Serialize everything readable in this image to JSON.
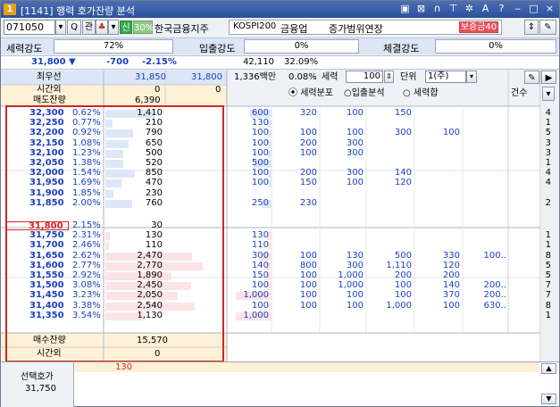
{
  "title": {
    "num": "1",
    "text": "[1141] 행력 호가잔량 분석"
  },
  "toolbar": {
    "code": "071050",
    "search_label": "Q",
    "gwan": "관",
    "sin": "신",
    "pct": "30%",
    "company": "한국금융지주",
    "market": "KOSPI200",
    "sector": "금융업",
    "status": "증가범위연장",
    "badge": "보증금40"
  },
  "strength": {
    "label": "세력강도",
    "value": "72%",
    "inout_label": "입출강도",
    "inout_value": "0%",
    "exec_label": "체결강도",
    "exec_value": "0%"
  },
  "summary": {
    "price": "31,800",
    "arrow": "▼",
    "change": "-700",
    "change_pct": "-2.15%",
    "volume": "42,110",
    "vol_pct": "32.09%",
    "best_label": "최우선",
    "best_ask": "31,850",
    "best_bid": "31,800",
    "amount": "1,336백만",
    "rate": "0.08%",
    "force_label": "세력",
    "force_value": "100",
    "unit_label": "단위",
    "unit_value": "1(주)"
  },
  "header": {
    "offhours": "시간외",
    "sell_total_label": "매도잔량",
    "sell_off_a": "0",
    "sell_off_b": "0",
    "sell_total": "6,390",
    "radio1": "세력분포",
    "radio2": "입출분석",
    "radio3": "세력합",
    "count_label": "건수"
  },
  "sell_rows": [
    {
      "price": "32,300",
      "pct": "0.62%",
      "qty": "1,410",
      "cols": [
        "600",
        "320",
        "100",
        "150",
        "",
        ""
      ],
      "cnt": "4"
    },
    {
      "price": "32,250",
      "pct": "0.77%",
      "qty": "210",
      "cols": [
        "130",
        "",
        "",
        "",
        "",
        ""
      ],
      "cnt": "1"
    },
    {
      "price": "32,200",
      "pct": "0.92%",
      "qty": "790",
      "cols": [
        "100",
        "100",
        "100",
        "300",
        "100",
        ""
      ],
      "cnt": "5"
    },
    {
      "price": "32,150",
      "pct": "1.08%",
      "qty": "650",
      "cols": [
        "100",
        "200",
        "300",
        "",
        "",
        ""
      ],
      "cnt": "3"
    },
    {
      "price": "32,100",
      "pct": "1.23%",
      "qty": "500",
      "cols": [
        "100",
        "100",
        "300",
        "",
        "",
        ""
      ],
      "cnt": "3"
    },
    {
      "price": "32,050",
      "pct": "1.38%",
      "qty": "520",
      "cols": [
        "500",
        "",
        "",
        "",
        "",
        ""
      ],
      "cnt": "1"
    },
    {
      "price": "32,000",
      "pct": "1.54%",
      "qty": "850",
      "cols": [
        "100",
        "200",
        "300",
        "140",
        "",
        ""
      ],
      "cnt": "4"
    },
    {
      "price": "31,950",
      "pct": "1.69%",
      "qty": "470",
      "cols": [
        "100",
        "150",
        "100",
        "120",
        "",
        ""
      ],
      "cnt": "4"
    },
    {
      "price": "31,900",
      "pct": "1.85%",
      "qty": "230",
      "cols": [
        "",
        "",
        "",
        "",
        "",
        ""
      ],
      "cnt": ""
    },
    {
      "price": "31,850",
      "pct": "2.00%",
      "qty": "760",
      "cols": [
        "250",
        "230",
        "",
        "",
        "",
        ""
      ],
      "cnt": "2"
    }
  ],
  "buy_rows": [
    {
      "price": "31,800",
      "pct": "2.15%",
      "qty": "30",
      "cols": [
        "",
        "",
        "",
        "",
        "",
        ""
      ],
      "cnt": ""
    },
    {
      "price": "31,750",
      "pct": "2.31%",
      "qty": "130",
      "cols": [
        "130",
        "",
        "",
        "",
        "",
        ""
      ],
      "cnt": "1"
    },
    {
      "price": "31,700",
      "pct": "2.46%",
      "qty": "110",
      "cols": [
        "110",
        "",
        "",
        "",
        "",
        ""
      ],
      "cnt": "1"
    },
    {
      "price": "31,650",
      "pct": "2.62%",
      "qty": "2,470",
      "cols": [
        "300",
        "100",
        "130",
        "500",
        "330",
        "100.."
      ],
      "cnt": "8"
    },
    {
      "price": "31,600",
      "pct": "2.77%",
      "qty": "2,770",
      "cols": [
        "140",
        "800",
        "300",
        "1,110",
        "120",
        ""
      ],
      "cnt": "5"
    },
    {
      "price": "31,550",
      "pct": "2.92%",
      "qty": "1,890",
      "cols": [
        "150",
        "100",
        "1,000",
        "200",
        "200",
        ""
      ],
      "cnt": "5"
    },
    {
      "price": "31,500",
      "pct": "3.08%",
      "qty": "2,450",
      "cols": [
        "100",
        "100",
        "1,000",
        "100",
        "140",
        "200.."
      ],
      "cnt": "7"
    },
    {
      "price": "31,450",
      "pct": "3.23%",
      "qty": "2,050",
      "cols": [
        "1,000",
        "100",
        "100",
        "100",
        "370",
        "200.."
      ],
      "cnt": "7"
    },
    {
      "price": "31,400",
      "pct": "3.38%",
      "qty": "2,540",
      "cols": [
        "100",
        "100",
        "100",
        "1,000",
        "100",
        "630.."
      ],
      "cnt": "8"
    },
    {
      "price": "31,350",
      "pct": "3.54%",
      "qty": "1,130",
      "cols": [
        "1,000",
        "",
        "",
        "",
        "",
        ""
      ],
      "cnt": "1"
    }
  ],
  "footer": {
    "buy_total_label": "매수잔량",
    "buy_total": "15,570",
    "offhours": "시간외",
    "buy_off": "0",
    "select_label": "선택호가",
    "select_price": "31,750",
    "select_qty": "130"
  }
}
